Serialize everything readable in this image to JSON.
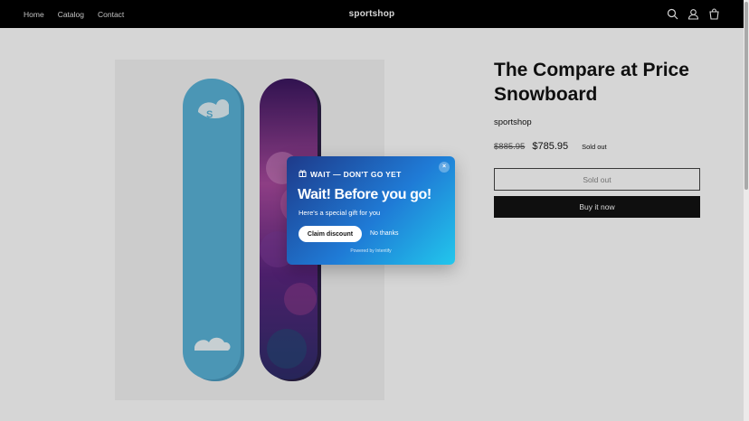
{
  "header": {
    "nav": [
      "Home",
      "Catalog",
      "Contact"
    ],
    "brand": "sportshop",
    "icons": [
      "search-icon",
      "account-icon",
      "cart-icon"
    ]
  },
  "product": {
    "title": "The Compare at Price Snowboard",
    "vendor": "sportshop",
    "compare_price": "$885.95",
    "price": "$785.95",
    "badge": "Sold out",
    "sold_out_button": "Sold out",
    "buy_button": "Buy it now",
    "image_alt": "Two snowboards: light blue and purple-pink"
  },
  "popup": {
    "eyebrow": "WAIT — DON'T GO YET",
    "heading": "Wait! Before you go!",
    "subtext": "Here's a special gift for you",
    "claim": "Claim discount",
    "no_thanks": "No thanks",
    "powered": "Powered by Intentify",
    "close": "×"
  },
  "colors": {
    "header_bg": "#000000",
    "popup_gradient_start": "#1e3a8a",
    "popup_gradient_end": "#22c7ec",
    "board_blue": "#5ab3d8",
    "board_purple": "#6a2b86"
  }
}
